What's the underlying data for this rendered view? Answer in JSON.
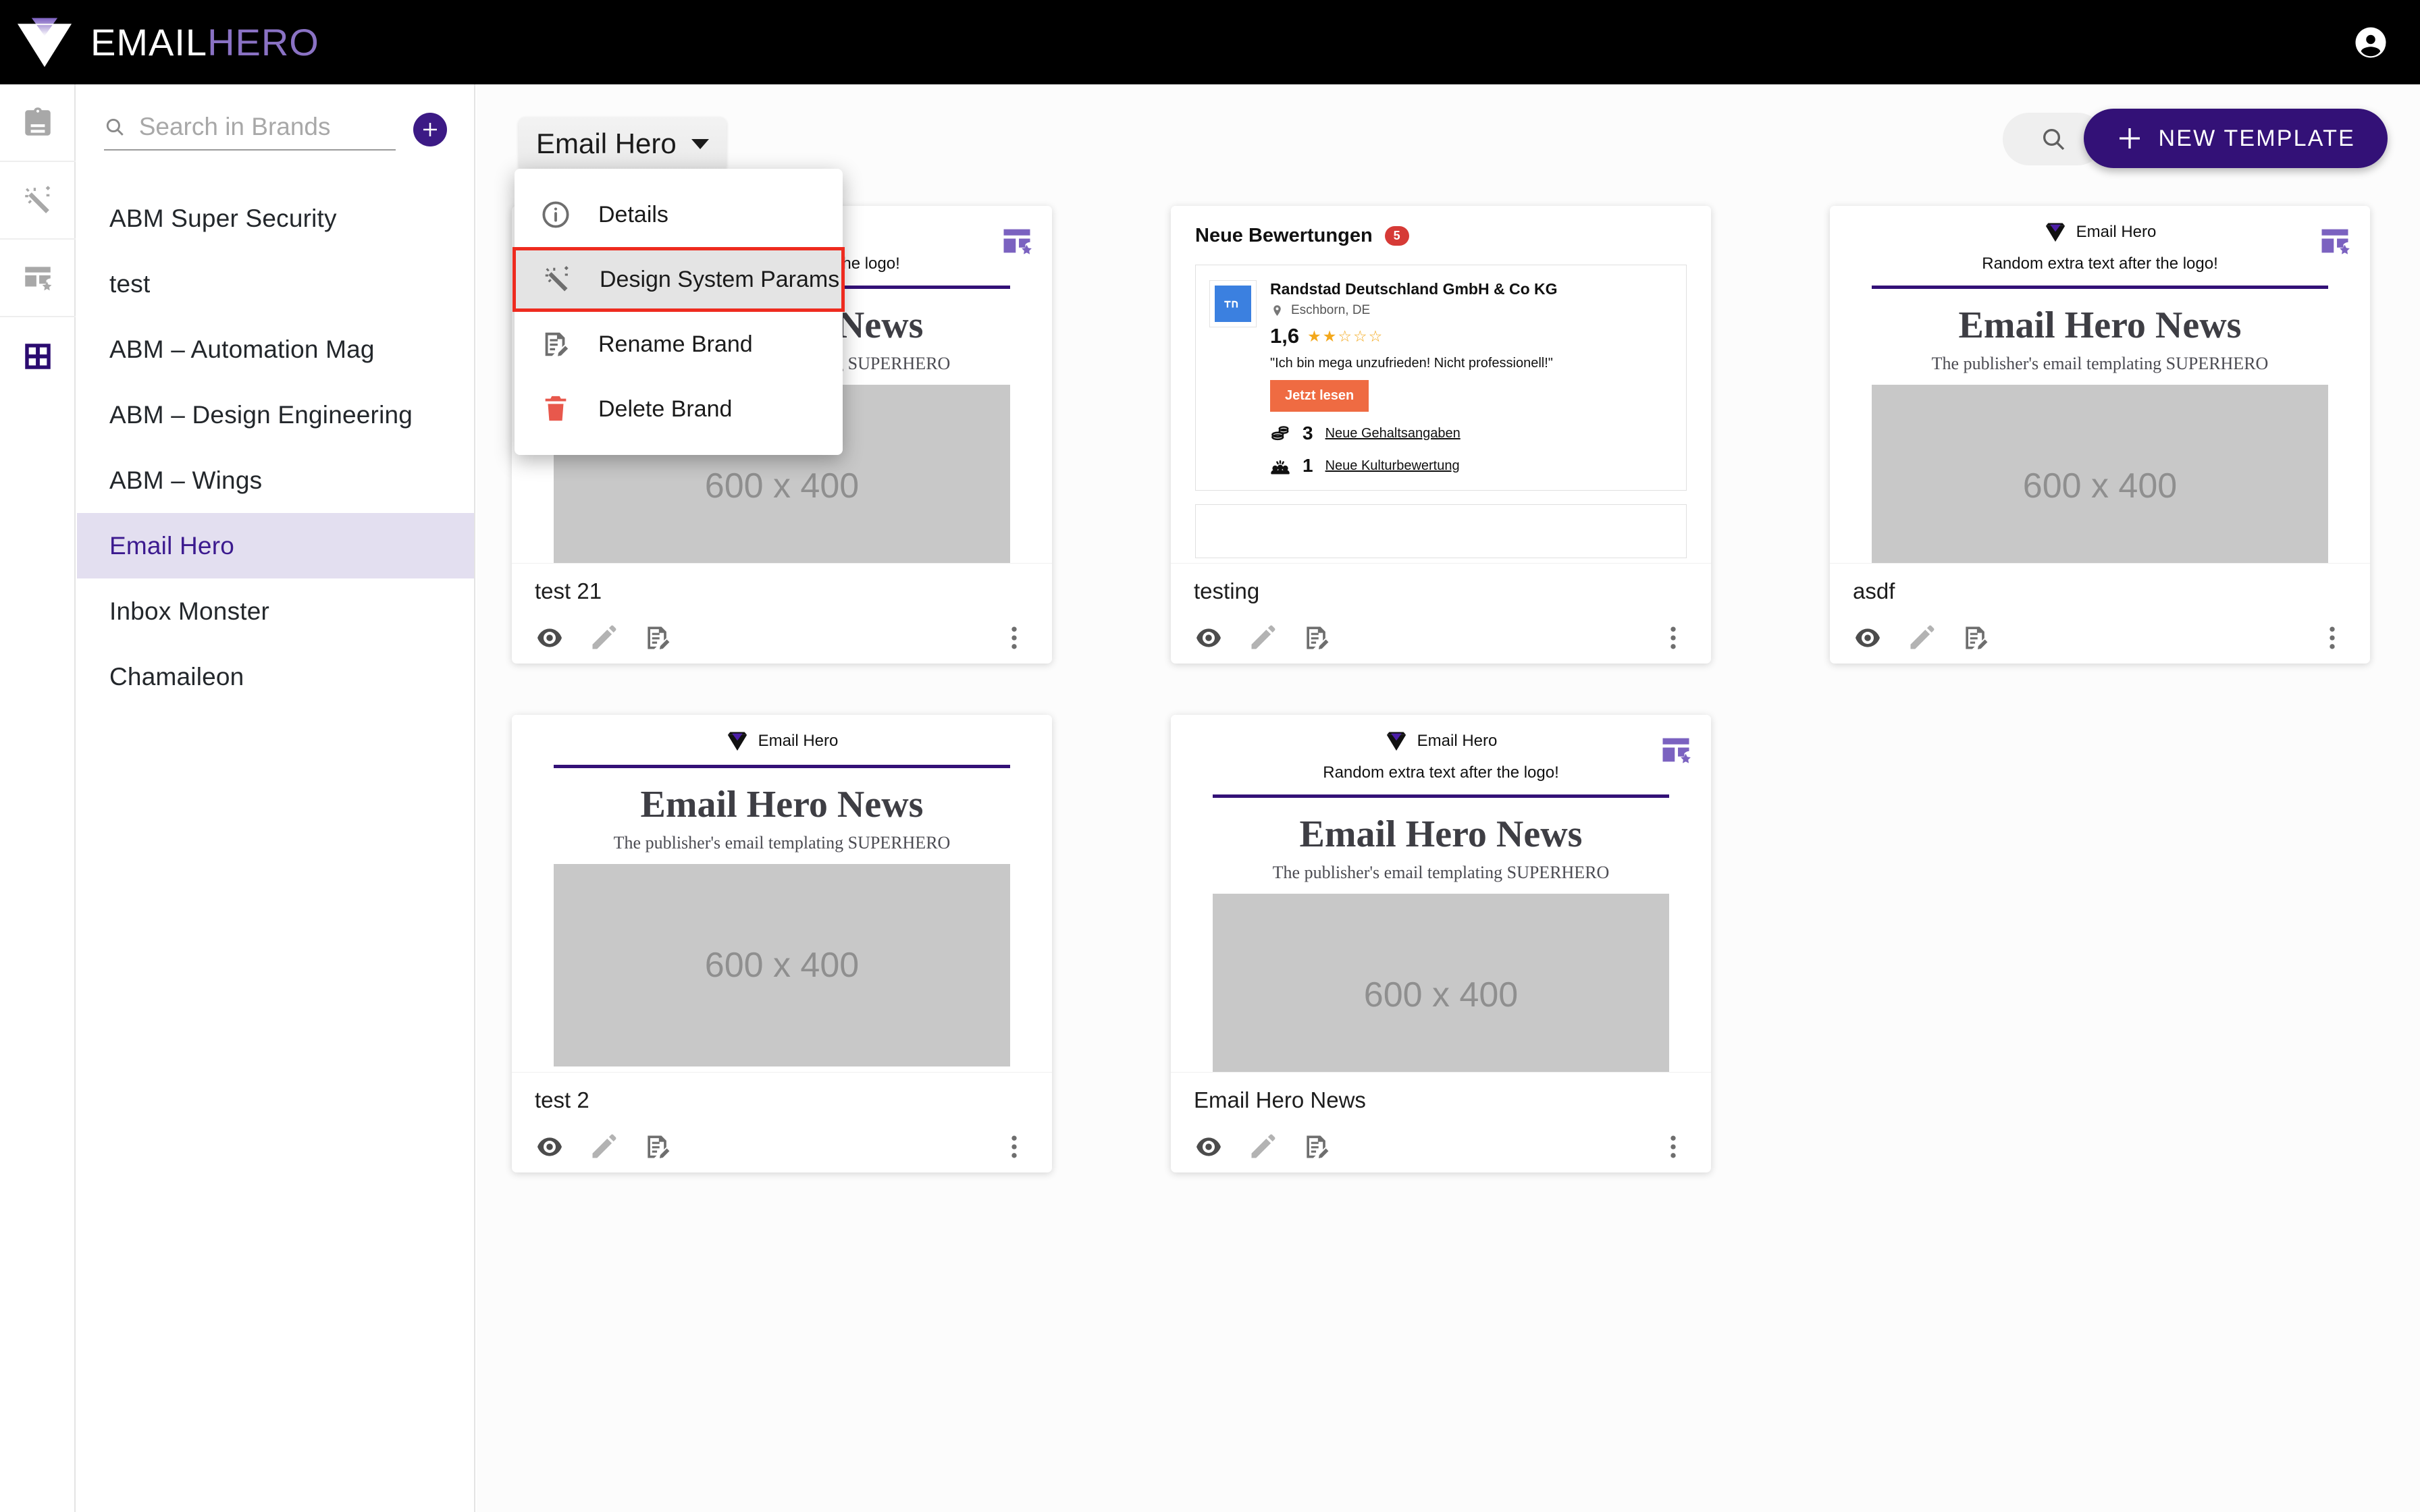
{
  "app": {
    "logo_email": "EMAIL",
    "logo_hero": "HERO",
    "logo_icon": "diamond-logo",
    "avatar_icon": "account-circle-icon"
  },
  "rail": {
    "items": [
      {
        "icon": "clipboard-icon",
        "name": "rail-item-clipboard",
        "active": false
      },
      {
        "icon": "magic-wand-icon",
        "name": "rail-item-design",
        "active": false
      },
      {
        "icon": "template-star-icon",
        "name": "rail-item-favorites",
        "active": false
      },
      {
        "icon": "grid-icon",
        "name": "rail-item-templates",
        "active": true
      }
    ]
  },
  "brands_panel": {
    "search_placeholder": "Search in Brands",
    "search_value": "",
    "search_icon": "search-icon",
    "add_icon": "plus-icon",
    "items": [
      {
        "label": "ABM Super Security",
        "selected": false
      },
      {
        "label": "test",
        "selected": false
      },
      {
        "label": "ABM – Automation Mag",
        "selected": false
      },
      {
        "label": "ABM – Design Engineering",
        "selected": false
      },
      {
        "label": "ABM – Wings",
        "selected": false
      },
      {
        "label": "Email Hero",
        "selected": true
      },
      {
        "label": "Inbox Monster",
        "selected": false
      },
      {
        "label": "Chamaileon",
        "selected": false
      }
    ]
  },
  "toolbar": {
    "brand_dropdown_label": "Email Hero",
    "search_icon": "search-icon",
    "new_template_label": "NEW TEMPLATE",
    "new_template_plus": "+"
  },
  "context_menu": {
    "items": [
      {
        "label": "Details",
        "icon": "info-icon",
        "highlighted": false
      },
      {
        "label": "Design System Params",
        "icon": "magic-wand-icon",
        "highlighted": true
      },
      {
        "label": "Rename Brand",
        "icon": "document-edit-icon",
        "highlighted": false
      },
      {
        "label": "Delete Brand",
        "icon": "trash-icon",
        "highlighted": false
      }
    ]
  },
  "newsletter": {
    "logo_label": "Email Hero",
    "extra_text": "Random extra text after the logo!",
    "title": "Email Hero News",
    "subtitle": "The publisher's email templating SUPERHERO",
    "image_placeholder": "600 x 400"
  },
  "review_preview": {
    "heading": "Neue Bewertungen",
    "badge": "5",
    "company": "Randstad Deutschland GmbH & Co KG",
    "location": "Eschborn, DE",
    "score": "1,6",
    "stars": "★★☆☆☆",
    "quote": "\"Ich bin mega unzufrieden! Nicht professionell!\"",
    "cta": "Jetzt lesen",
    "stat1_num": "3",
    "stat1_label": "Neue Gehaltsangaben",
    "stat2_num": "1",
    "stat2_label": "Neue Kulturbewertung"
  },
  "cards": [
    {
      "name": "test 21",
      "type": "newsletter",
      "has_extra": true,
      "starred": true
    },
    {
      "name": "testing",
      "type": "review",
      "has_extra": false,
      "starred": false
    },
    {
      "name": "asdf",
      "type": "newsletter",
      "has_extra": true,
      "starred": true
    },
    {
      "name": "test 2",
      "type": "newsletter",
      "has_extra": false,
      "starred": false
    },
    {
      "name": "Email Hero News",
      "type": "newsletter",
      "has_extra": true,
      "starred": true
    }
  ],
  "card_actions": {
    "preview_icon": "eye-icon",
    "edit_icon": "pencil-icon",
    "rename_icon": "document-edit-icon",
    "more_icon": "three-dots-icon"
  },
  "colors": {
    "brand_purple": "#331177",
    "accent_lavender": "#e3dff0",
    "highlight_red": "#ee2b1f",
    "delete_red": "#e8584c",
    "cta_orange": "#ef6b42",
    "badge_red": "#d63a36",
    "star_gold": "#f3a81c"
  }
}
